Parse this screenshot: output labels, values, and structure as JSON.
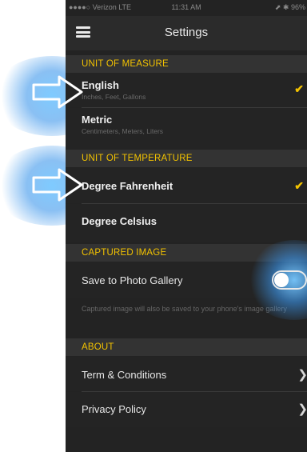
{
  "status_bar": {
    "carrier": "●●●●○ Verizon  LTE",
    "time": "11:31 AM",
    "battery": "⬈ ✱ 96%"
  },
  "header": {
    "menu_icon": "hamburger-icon",
    "title": "Settings"
  },
  "sections": {
    "unit_of_measure": {
      "title": "UNIT OF MEASURE",
      "english": {
        "label": "English",
        "sub": "Inches, Feet, Gallons",
        "selected": true
      },
      "metric": {
        "label": "Metric",
        "sub": "Centimeters, Meters, Liters",
        "selected": false
      }
    },
    "unit_of_temperature": {
      "title": "UNIT OF TEMPERATURE",
      "fahrenheit": {
        "label": "Degree Fahrenheit",
        "selected": true
      },
      "celsius": {
        "label": "Degree Celsius",
        "selected": false
      }
    },
    "captured_image": {
      "title": "CAPTURED IMAGE",
      "save_label": "Save to Photo Gallery",
      "save_enabled": false,
      "info": "Captured image will also be saved to your phone's image gallery"
    },
    "about": {
      "title": "ABOUT",
      "terms": "Term & Conditions",
      "privacy": "Privacy Policy"
    }
  },
  "icons": {
    "check": "✔",
    "chevron": "❯"
  },
  "colors": {
    "accent": "#f2c200",
    "background": "#232323",
    "highlight_glow": "#4aa6f0"
  }
}
